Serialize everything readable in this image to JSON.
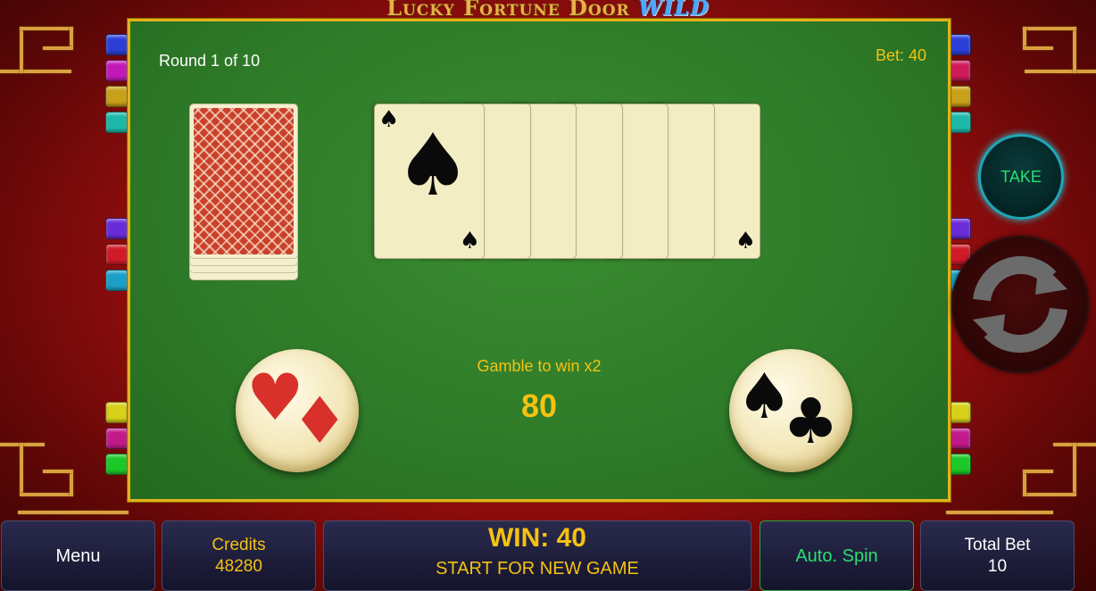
{
  "game": {
    "title_main": "Lucky Fortune Door",
    "title_wild": "WILD"
  },
  "gamble": {
    "round_text": "Round 1 of 10",
    "bet_text": "Bet: 40",
    "label": "Gamble to win x2",
    "value": "80"
  },
  "cards": [
    {
      "suit": "♠",
      "color": "black"
    },
    {
      "suit": "♥",
      "color": "red"
    },
    {
      "suit": "♠",
      "color": "black"
    },
    {
      "suit": "♦",
      "color": "red"
    },
    {
      "suit": "♦",
      "color": "red"
    },
    {
      "suit": "♣",
      "color": "black"
    },
    {
      "suit": "♠",
      "color": "black"
    }
  ],
  "controls": {
    "take_label": "TAKE",
    "red_choice_icons": [
      "♥",
      "♦"
    ],
    "black_choice_icons": [
      "♠",
      "♣"
    ]
  },
  "bottom_bar": {
    "menu_label": "Menu",
    "credits_label": "Credits",
    "credits_value": "48280",
    "win_text": "WIN: 40",
    "status_text": "START FOR NEW GAME",
    "autospin_label": "Auto. Spin",
    "total_bet_label": "Total Bet",
    "total_bet_value": "10"
  },
  "colors": {
    "felt": "#2e7a28",
    "gold": "#f5c211",
    "take_text": "#28e070"
  }
}
